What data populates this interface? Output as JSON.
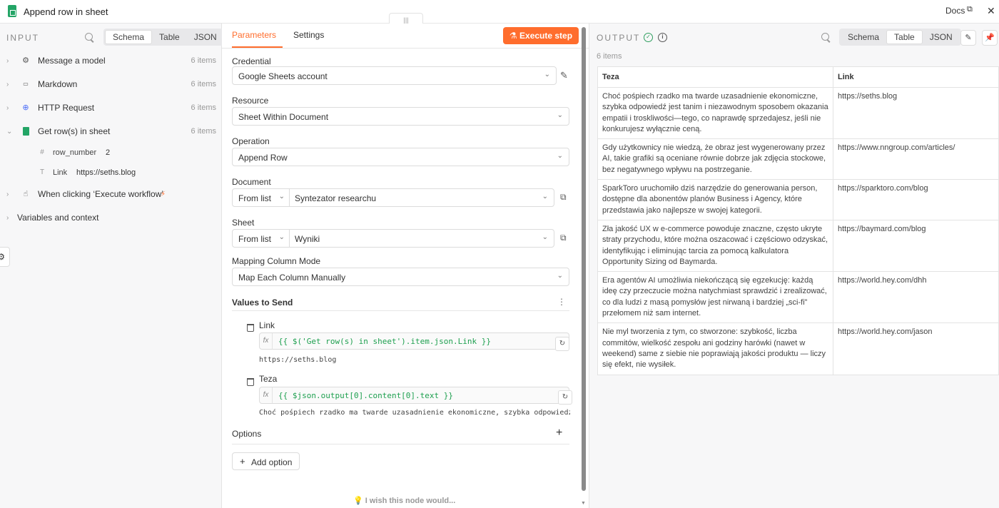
{
  "header": {
    "title": "Append row in sheet",
    "docs_label": "Docs",
    "docs_ext": "⧉",
    "close": "✕",
    "drag_glyph": "|||"
  },
  "input": {
    "label": "INPUT",
    "view_tabs": [
      "Schema",
      "Table",
      "JSON"
    ],
    "active_view": "Schema",
    "nodes": [
      {
        "label": "Message a model",
        "count": "6 items",
        "icon": "openai-icon"
      },
      {
        "label": "Markdown",
        "count": "6 items",
        "icon": "markdown-icon"
      },
      {
        "label": "HTTP Request",
        "count": "6 items",
        "icon": "globe-icon"
      },
      {
        "label": "Get row(s) in sheet",
        "count": "6 items",
        "icon": "google-sheets-icon"
      }
    ],
    "fields": [
      {
        "type_glyph": "#",
        "name": "row_number",
        "value": "2"
      },
      {
        "type_glyph": "T",
        "name": "Link",
        "value": "https://seths.blog"
      }
    ],
    "trigger_node": {
      "label": "When clicking ‘Execute workflow’",
      "bolt": "⚡"
    },
    "variables_label": "Variables and context"
  },
  "params": {
    "tab_parameters": "Parameters",
    "tab_settings": "Settings",
    "execute_label": "Execute step",
    "credential_label": "Credential",
    "credential_value": "Google Sheets account",
    "resource_label": "Resource",
    "resource_value": "Sheet Within Document",
    "operation_label": "Operation",
    "operation_value": "Append Row",
    "document_label": "Document",
    "document_mode": "From list",
    "document_value": "Syntezator researchu",
    "sheet_label": "Sheet",
    "sheet_mode": "From list",
    "sheet_value": "Wyniki",
    "mapping_label": "Mapping Column Mode",
    "mapping_value": "Map Each Column Manually",
    "values_title": "Values to Send",
    "values": [
      {
        "name": "Link",
        "expr": "{{ $('Get row(s) in sheet').item.json.Link }}",
        "preview": "https://seths.blog"
      },
      {
        "name": "Teza",
        "expr": "{{ $json.output[0].content[0].text }}",
        "preview": "Choć pośpiech rzadko ma twarde uzasadnienie ekonomiczne, szybka odpowiedź j…"
      }
    ],
    "options_label": "Options",
    "add_option_label": "Add option",
    "wish_text": "I wish this node would..."
  },
  "output": {
    "label": "OUTPUT",
    "items_count": "6 items",
    "view_tabs": [
      "Schema",
      "Table",
      "JSON"
    ],
    "active_view": "Table",
    "columns": [
      "Teza",
      "Link"
    ],
    "rows": [
      {
        "teza": "Choć pośpiech rzadko ma twarde uzasadnienie ekonomiczne, szybka odpowiedź jest tanim i niezawodnym sposobem okazania empatii i troskliwości—tego, co naprawdę sprzedajesz, jeśli nie konkurujesz wyłącznie ceną.",
        "link": "https://seths.blog"
      },
      {
        "teza": "Gdy użytkownicy nie wiedzą, że obraz jest wygenerowany przez AI, takie grafiki są oceniane równie dobrze jak zdjęcia stockowe, bez negatywnego wpływu na postrzeganie.",
        "link": "https://www.nngroup.com/articles/"
      },
      {
        "teza": "SparkToro uruchomiło dziś narzędzie do generowania person, dostępne dla abonentów planów Business i Agency, które przedstawia jako najlepsze w swojej kategorii.",
        "link": "https://sparktoro.com/blog"
      },
      {
        "teza": "Zła jakość UX w e-commerce powoduje znaczne, często ukryte straty przychodu, które można oszacować i częściowo odzyskać, identyfikując i eliminując tarcia za pomocą kalkulatora Opportunity Sizing od Baymarda.",
        "link": "https://baymard.com/blog"
      },
      {
        "teza": "Era agentów AI umożliwia niekończącą się egzekucję: każdą ideę czy przeczucie można natychmiast sprawdzić i zrealizować, co dla ludzi z masą pomysłów jest nirwaną i bardziej „sci-fi” przełomem niż sam internet.",
        "link": "https://world.hey.com/dhh"
      },
      {
        "teza": "Nie myl tworzenia z tym, co stworzone: szybkość, liczba commitów, wielkość zespołu ani godziny harówki (nawet w weekend) same z siebie nie poprawiają jakości produktu — liczy się efekt, nie wysiłek.",
        "link": "https://world.hey.com/jason"
      }
    ]
  },
  "colors": {
    "accent": "#ff6d2d",
    "success": "#2e9e5e",
    "expression": "#1fa050"
  }
}
